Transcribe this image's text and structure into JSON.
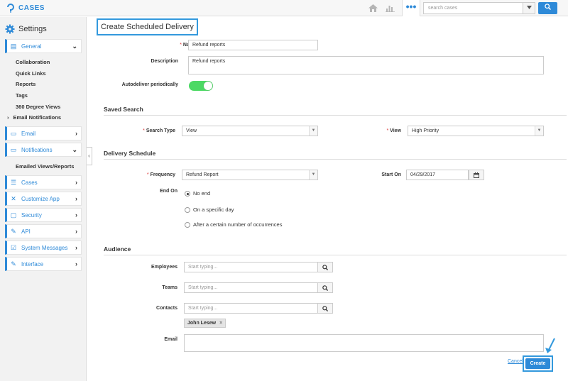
{
  "app": {
    "title": "CASES"
  },
  "topbar": {
    "search_placeholder": "search cases",
    "accent": "#2e8ad8"
  },
  "sidebar": {
    "title": "Settings",
    "general": {
      "label": "General",
      "items": [
        "Collaboration",
        "Quick Links",
        "Reports",
        "Tags",
        "360 Degree Views"
      ],
      "email_notifications": "Email Notifications"
    },
    "email": "Email",
    "notifications": {
      "label": "Notifications",
      "items": [
        "Emailed Views/Reports"
      ]
    },
    "cases": "Cases",
    "customize_app": "Customize App",
    "security": "Security",
    "api": "API",
    "system_messages": "System Messages",
    "interface": "Interface"
  },
  "form": {
    "title": "Create Scheduled Delivery",
    "name_label": "Name",
    "name_value": "Refund reports",
    "description_label": "Description",
    "description_value": "Refund reports",
    "autodeliver_label": "Autodeliver periodically",
    "autodeliver_on": true,
    "saved_search": {
      "heading": "Saved Search",
      "search_type_label": "Search Type",
      "search_type_value": "View",
      "view_label": "View",
      "view_value": "High Priority"
    },
    "delivery": {
      "heading": "Delivery Schedule",
      "frequency_label": "Frequency",
      "frequency_value": "Refund Report",
      "start_on_label": "Start On",
      "start_on_value": "04/29/2017",
      "end_on_label": "End On",
      "end_options": [
        "No end",
        "On a specific day",
        "After a certain number of occurrences"
      ],
      "end_selected": 0
    },
    "audience": {
      "heading": "Audience",
      "employees_label": "Employees",
      "teams_label": "Teams",
      "contacts_label": "Contacts",
      "placeholder": "Start typing...",
      "contact_tag": "John Lesew",
      "email_label": "Email"
    },
    "cancel_label": "Cancel",
    "create_label": "Create"
  }
}
